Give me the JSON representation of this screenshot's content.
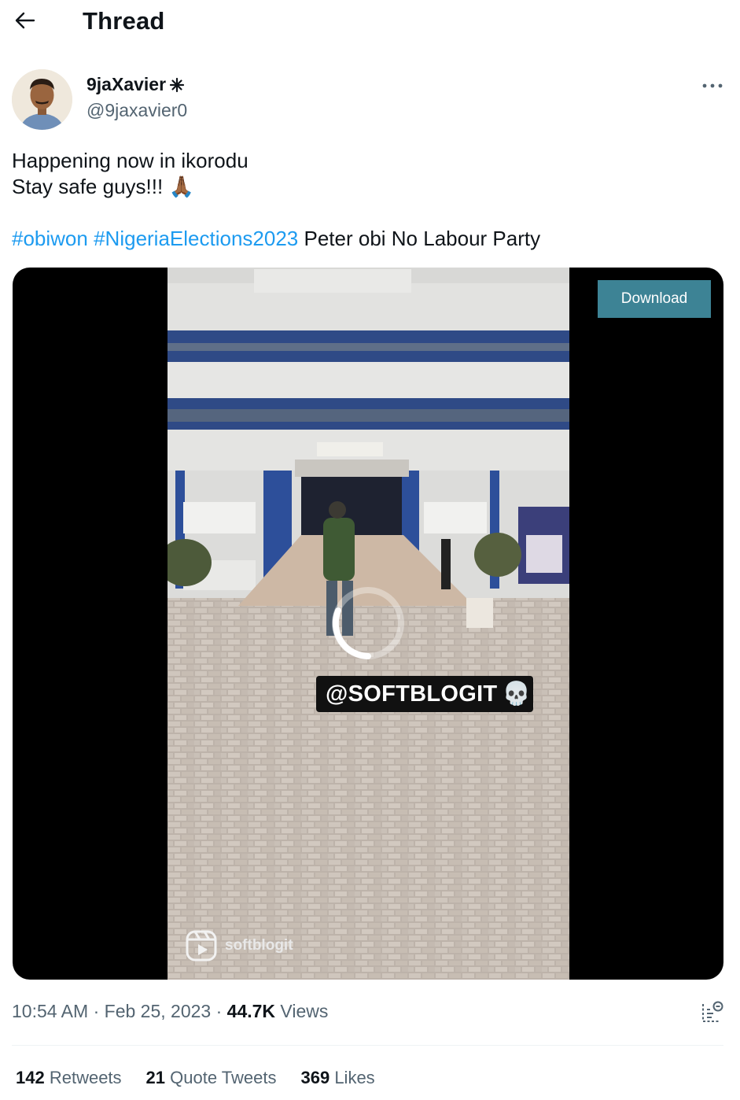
{
  "header": {
    "title": "Thread",
    "back_icon": "arrow-left-icon"
  },
  "author": {
    "display_name": "9jaXavier",
    "badge_icon": "sparkle-badge-icon",
    "handle": "@9jaxavier0",
    "avatar_icon": "user-avatar"
  },
  "tweet": {
    "line1": "Happening now in ikorodu",
    "line2": "Stay safe guys!!!",
    "emoji": "🙏🏾",
    "hashtag1": "#obiwon",
    "hashtag2": "#NigeriaElections2023",
    "line3_rest": " Peter obi No Labour Party"
  },
  "media": {
    "download_label": "Download",
    "watermark_text": "@SOFTBLOGIT",
    "watermark_emoji": "💀",
    "reels_label": "softblogit",
    "spinner_icon": "loading-spinner-icon"
  },
  "meta": {
    "time": "10:54 AM",
    "separator": " · ",
    "date": "Feb 25, 2023",
    "views_count": "44.7K",
    "views_label": " Views",
    "analytics_icon": "analytics-icon"
  },
  "stats": {
    "retweets_count": "142",
    "retweets_label": " Retweets",
    "quotes_count": "21",
    "quotes_label": " Quote Tweets",
    "likes_count": "369",
    "likes_label": " Likes"
  },
  "colors": {
    "link": "#1d9bf0",
    "secondary_text": "#536471",
    "primary_text": "#0f1419",
    "download_button": "#3d8395"
  }
}
